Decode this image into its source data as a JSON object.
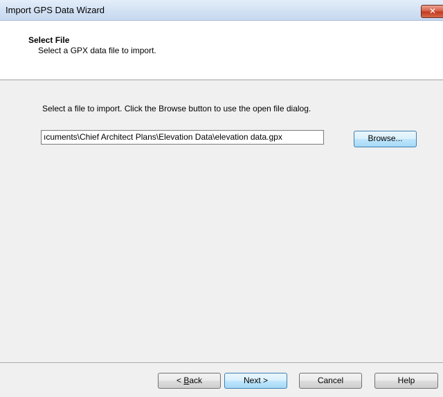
{
  "window": {
    "title": "Import GPS Data Wizard",
    "close_glyph": "✕"
  },
  "header": {
    "title": "Select File",
    "subtitle": "Select a GPX data file to import."
  },
  "body": {
    "instructions": "Select a file to import.  Click the Browse button to use the open file dialog.",
    "file_path_value": "C:\\Users\\Documents\\Chief Architect Plans\\Elevation Data\\elevation data.gpx",
    "file_path_visible": "ıcuments\\Chief Architect Plans\\Elevation Data\\elevation data.gpx",
    "browse_label": "Browse..."
  },
  "footer": {
    "back_label": "< Back",
    "back_prefix": "< ",
    "back_mnemonic": "B",
    "back_rest": "ack",
    "next_label": "Next >",
    "cancel_label": "Cancel",
    "help_label": "Help"
  }
}
